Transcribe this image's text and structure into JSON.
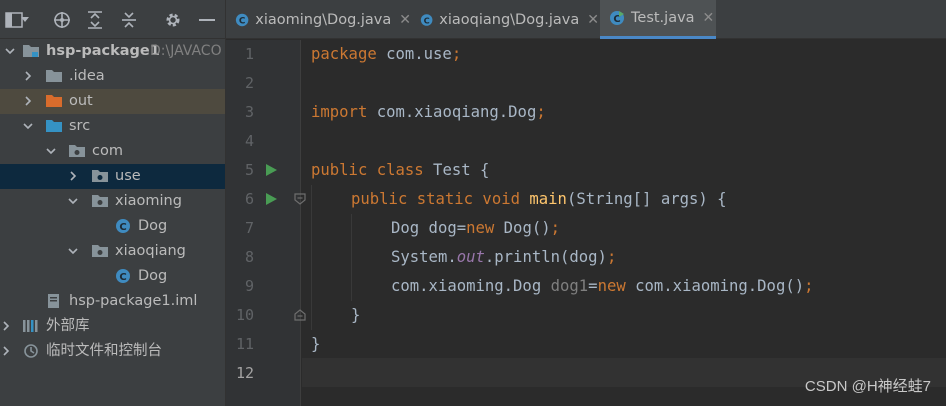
{
  "project": {
    "root_name": "hsp-package1",
    "root_path": "D:\\JAVACO",
    "items": [
      {
        "label": "hsp-package1"
      },
      {
        "label": ".idea"
      },
      {
        "label": "out"
      },
      {
        "label": "src"
      },
      {
        "label": "com"
      },
      {
        "label": "use"
      },
      {
        "label": "xiaoming"
      },
      {
        "label": "Dog"
      },
      {
        "label": "xiaoqiang"
      },
      {
        "label": "Dog"
      },
      {
        "label": "hsp-package1.iml"
      },
      {
        "label": "外部库"
      },
      {
        "label": "临时文件和控制台"
      }
    ]
  },
  "tabs": [
    {
      "label": "xiaoming\\Dog.java",
      "active": false
    },
    {
      "label": "xiaoqiang\\Dog.java",
      "active": false
    },
    {
      "label": "Test.java",
      "active": true
    }
  ],
  "editor": {
    "line_numbers": [
      "1",
      "2",
      "3",
      "4",
      "5",
      "6",
      "7",
      "8",
      "9",
      "10",
      "11",
      "12"
    ],
    "current_line": "12",
    "code": {
      "l1_kw": "package",
      "l1_rest": " com.use",
      "l1_semi": ";",
      "l3_kw": "import",
      "l3_rest": " com.xiaoqiang.Dog",
      "l3_semi": ";",
      "l5_kw": "public class",
      "l5_rest": " Test {",
      "l6_kw": "public static void",
      "l6_fn": "main",
      "l6_rest": "(String[] args) {",
      "l7_a": "Dog dog=",
      "l7_kw": "new",
      "l7_b": " Dog()",
      "l7_semi": ";",
      "l8_a": "System.",
      "l8_st": "out",
      "l8_b": ".println(dog)",
      "l8_semi": ";",
      "l9_a": "com.xiaoming.Dog ",
      "l9_unused": "dog1",
      "l9_b": "=",
      "l9_kw": "new",
      "l9_c": " com.xiaoming.Dog()",
      "l9_semi": ";",
      "l10": "}",
      "l11": "}"
    }
  },
  "watermark": "CSDN @H神经蛙7",
  "colors": {
    "background": "#2b2b2b",
    "panel": "#3c3f41",
    "selection": "#0d293e",
    "keyword": "#cc7832",
    "method": "#ffc66d",
    "static_field": "#9876aa",
    "text": "#a9b7c6",
    "tab_underline": "#4a88c7",
    "run_green": "#499c54"
  },
  "icons": [
    "panel-layout-icon",
    "locate-icon",
    "expand-all-icon",
    "collapse-all-icon",
    "gear-icon",
    "minimize-icon",
    "folder-icon",
    "package-icon",
    "class-icon",
    "module-file-icon",
    "library-icon",
    "scratch-icon",
    "run-icon",
    "fold-icon",
    "close-icon"
  ]
}
